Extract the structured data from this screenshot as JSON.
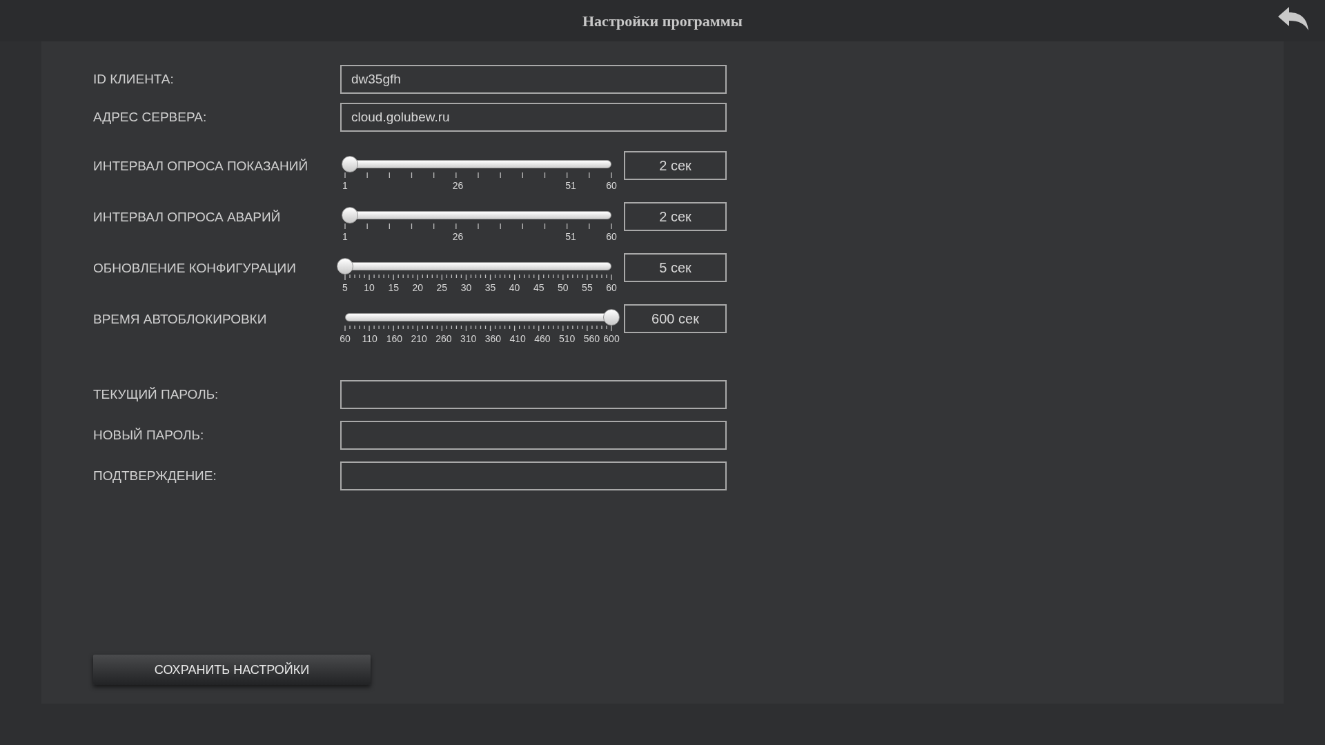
{
  "window": {
    "title": "Настройки программы"
  },
  "fields": [
    {
      "label": "ID КЛИЕНТА:",
      "value": "dw35gfh"
    },
    {
      "label": "АДРЕС СЕРВЕРА:",
      "value": "cloud.golubew.ru"
    }
  ],
  "sliders": [
    {
      "label": "ИНТЕРВАЛ ОПРОСА ПОКАЗАНИЙ",
      "kind": "coarse",
      "level": 0.017,
      "reading": "2 сек",
      "ticks": [
        "1",
        "26",
        "51",
        "60"
      ]
    },
    {
      "label": "ИНТЕРВАЛ ОПРОСА АВАРИЙ",
      "kind": "coarse",
      "level": 0.017,
      "reading": "2 сек",
      "ticks": [
        "1",
        "26",
        "51",
        "60"
      ]
    },
    {
      "label": "ОБНОВЛЕНИЕ КОНФИГУРАЦИИ",
      "kind": "fine",
      "level": 0,
      "reading": "5 сек",
      "ticks": [
        "5",
        "10",
        "15",
        "20",
        "25",
        "30",
        "35",
        "40",
        "45",
        "50",
        "55",
        "60"
      ]
    },
    {
      "label": "ВРЕМЯ АВТОБЛОКИРОВКИ",
      "kind": "fine",
      "level": 1,
      "reading": "600 сек",
      "ticks": [
        "60",
        "110",
        "160",
        "210",
        "260",
        "310",
        "360",
        "410",
        "460",
        "510",
        "560",
        "600"
      ]
    }
  ],
  "password_fields": [
    {
      "label": "ТЕКУЩИЙ ПАРОЛЬ:"
    },
    {
      "label": "НОВЫЙ ПАРОЛЬ:"
    },
    {
      "label": "ПОДТВЕРЖДЕНИЕ:"
    }
  ],
  "save_button": "СОХРАНИТЬ НАСТРОЙКИ"
}
